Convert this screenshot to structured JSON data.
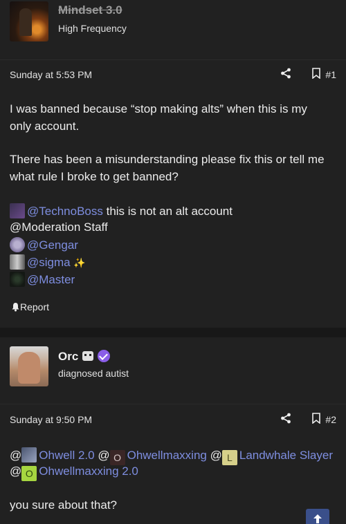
{
  "post1": {
    "author": {
      "name": "Mindset 3.0",
      "title": "High Frequency"
    },
    "date": "Sunday at 5:53 PM",
    "number": "#1",
    "body_lines": [
      "I was banned because “stop making alts” when this is my",
      "only account.",
      "There has been a misunderstanding please fix this or tell me",
      "what rule I broke to get banned?"
    ],
    "mentions": {
      "technoboss": "@TechnoBoss",
      "technoboss_suffix": " this is not an alt account",
      "moderation": "@Moderation Staff",
      "gengar": "@Gengar",
      "sigma": "@sigma",
      "sigma_badge": "✨",
      "master": "@Master"
    },
    "report_label": "Report"
  },
  "post2": {
    "author": {
      "name": "Orc",
      "title": "diagnosed autist"
    },
    "date": "Sunday at 9:50 PM",
    "number": "#2",
    "mentions": {
      "at1": "@",
      "ohwell": "Ohwell 2.0",
      "at2": "@",
      "ohwellmaxxing_letter": "O",
      "ohwellmaxxing": "Ohwellmaxxing",
      "at3": "@",
      "landwhale_letter": "L",
      "landwhale": "Landwhale Slayer",
      "at4": "@",
      "ohwellmaxxing2_letter": "O",
      "ohwellmaxxing2": "Ohwellmaxxing 2.0"
    },
    "body_line": "you sure about that?"
  },
  "colors": {
    "background": "#212121",
    "mention": "#7e8ee0",
    "verified": "#8a5ee8",
    "scroll_top_button": "#3a4f8a"
  },
  "icons": [
    "share-icon",
    "bookmark-icon",
    "bell-icon",
    "verified-badge-icon",
    "robot-icon",
    "arrow-up-icon"
  ]
}
